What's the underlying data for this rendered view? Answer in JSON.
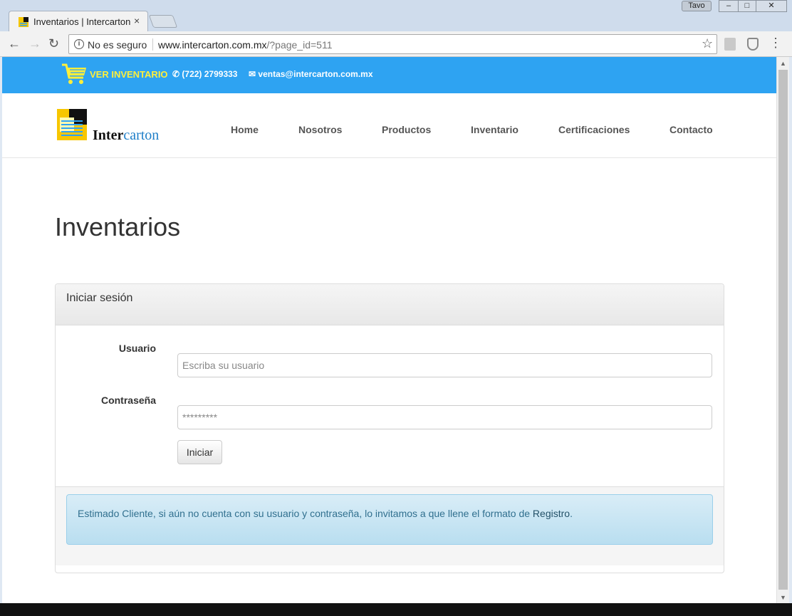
{
  "browser": {
    "tab_title": "Inventarios | Intercarton",
    "tab_close": "×",
    "user_name": "Tavo",
    "security_label": "No es seguro",
    "url_domain": "www.intercarton.com.mx",
    "url_path": "/?page_id=511",
    "icons": {
      "back": "back-arrow-icon",
      "forward": "forward-arrow-icon",
      "reload": "reload-icon",
      "info": "info-icon",
      "star": "star-icon",
      "menu": "kebab-menu-icon"
    }
  },
  "topbar": {
    "cart_label": "VER INVENTARIO",
    "phone": "(722) 2799333",
    "email": "ventas@intercarton.com.mx",
    "bg_color": "#2ea3f2",
    "cart_color": "#ffef3b"
  },
  "logo": {
    "text_black": "Inter",
    "text_blue": "carton"
  },
  "nav": {
    "items": [
      "Home",
      "Nosotros",
      "Productos",
      "Inventario",
      "Certificaciones",
      "Contacto"
    ]
  },
  "page": {
    "title": "Inventarios"
  },
  "login": {
    "heading": "Iniciar sesión",
    "user_label": "Usuario",
    "user_placeholder": "Escriba su usuario",
    "password_label": "Contraseña",
    "password_placeholder": "*********",
    "submit_label": "Iniciar"
  },
  "notice": {
    "text": "Estimado Cliente, si aún no cuenta con su usuario y contraseña, lo invitamos a que llene el formato de ",
    "link": "Registro",
    "end": "."
  }
}
